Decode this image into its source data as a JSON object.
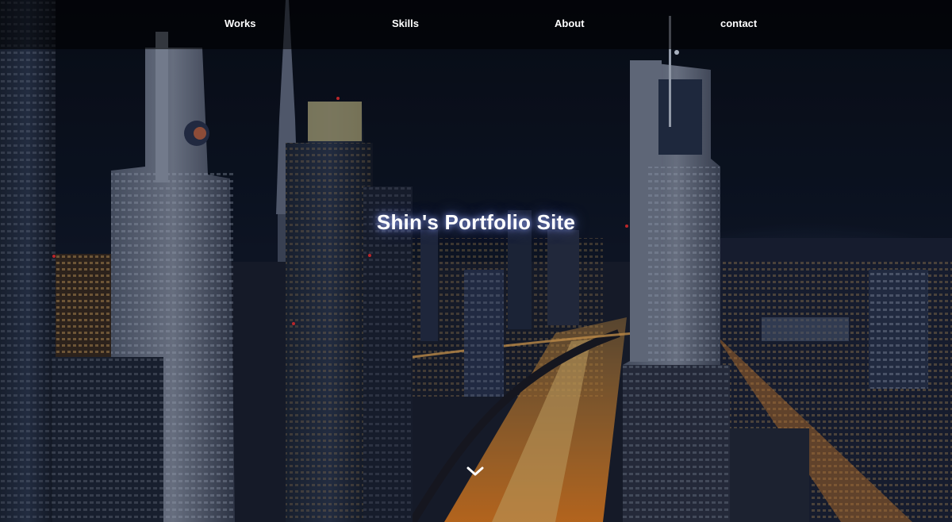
{
  "nav": {
    "items": [
      {
        "label": "Works"
      },
      {
        "label": "Skills"
      },
      {
        "label": "About"
      },
      {
        "label": "contact"
      }
    ]
  },
  "hero": {
    "title": "Shin's Portfolio Site",
    "background": "night-city-skyline-image",
    "scroll_icon": "chevron-down-icon"
  },
  "colors": {
    "nav_background": "#000000",
    "text": "#ffffff",
    "title_glow": "#8c9cff",
    "city_lights": "#ff9a2e"
  }
}
